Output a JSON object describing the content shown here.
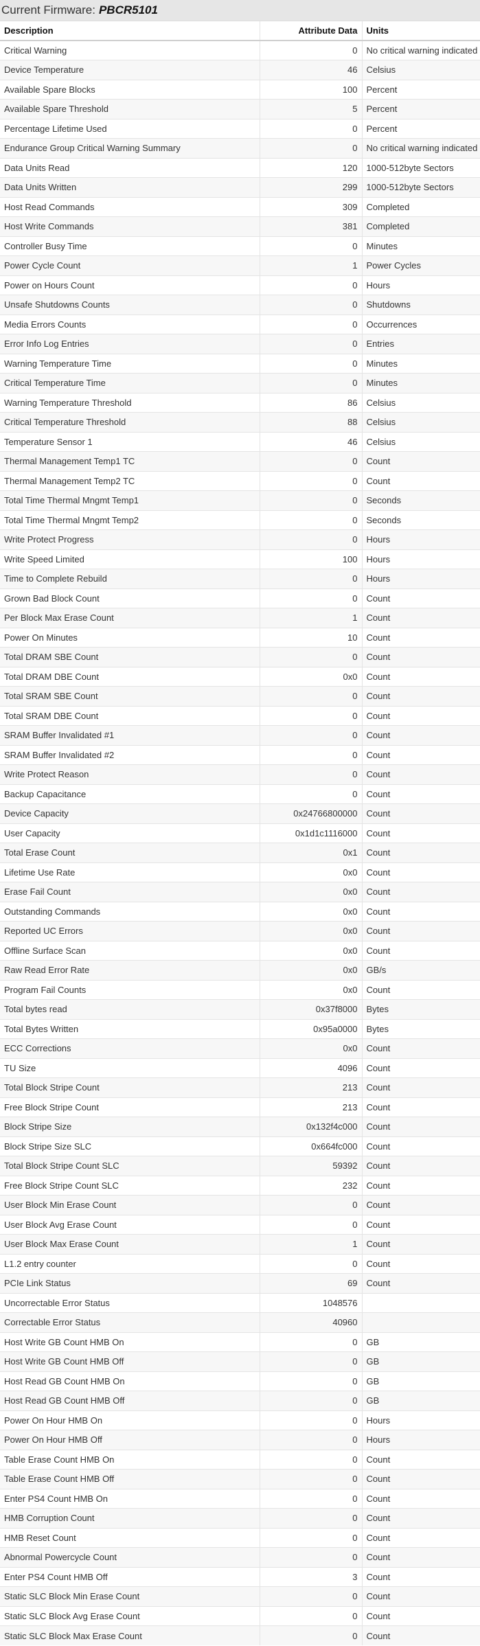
{
  "header": {
    "label": "Current Firmware:",
    "firmware": "PBCR5101"
  },
  "table": {
    "columns": [
      "Description",
      "Attribute Data",
      "Units"
    ],
    "rows": [
      {
        "d": "Critical Warning",
        "v": "0",
        "u": "No critical warning indicated"
      },
      {
        "d": "Device Temperature",
        "v": "46",
        "u": "Celsius"
      },
      {
        "d": "Available Spare Blocks",
        "v": "100",
        "u": "Percent"
      },
      {
        "d": "Available Spare Threshold",
        "v": "5",
        "u": "Percent"
      },
      {
        "d": "Percentage Lifetime Used",
        "v": "0",
        "u": "Percent"
      },
      {
        "d": "Endurance Group Critical Warning Summary",
        "v": "0",
        "u": "No critical warning indicated"
      },
      {
        "d": "Data Units Read",
        "v": "120",
        "u": "1000-512byte Sectors"
      },
      {
        "d": "Data Units Written",
        "v": "299",
        "u": "1000-512byte Sectors"
      },
      {
        "d": "Host Read Commands",
        "v": "309",
        "u": "Completed"
      },
      {
        "d": "Host Write Commands",
        "v": "381",
        "u": "Completed"
      },
      {
        "d": "Controller Busy Time",
        "v": "0",
        "u": "Minutes"
      },
      {
        "d": "Power Cycle Count",
        "v": "1",
        "u": "Power Cycles"
      },
      {
        "d": "Power on Hours Count",
        "v": "0",
        "u": "Hours"
      },
      {
        "d": "Unsafe Shutdowns Counts",
        "v": "0",
        "u": "Shutdowns"
      },
      {
        "d": "Media Errors Counts",
        "v": "0",
        "u": "Occurrences"
      },
      {
        "d": "Error Info Log Entries",
        "v": "0",
        "u": "Entries"
      },
      {
        "d": "Warning Temperature Time",
        "v": "0",
        "u": "Minutes"
      },
      {
        "d": "Critical Temperature Time",
        "v": "0",
        "u": "Minutes"
      },
      {
        "d": "Warning Temperature Threshold",
        "v": "86",
        "u": "Celsius"
      },
      {
        "d": "Critical Temperature Threshold",
        "v": "88",
        "u": "Celsius"
      },
      {
        "d": "Temperature Sensor 1",
        "v": "46",
        "u": "Celsius"
      },
      {
        "d": "Thermal Management Temp1 TC",
        "v": "0",
        "u": "Count"
      },
      {
        "d": "Thermal Management Temp2 TC",
        "v": "0",
        "u": "Count"
      },
      {
        "d": "Total Time Thermal Mngmt Temp1",
        "v": "0",
        "u": "Seconds"
      },
      {
        "d": "Total Time Thermal Mngmt Temp2",
        "v": "0",
        "u": "Seconds"
      },
      {
        "d": "Write Protect Progress",
        "v": "0",
        "u": "Hours"
      },
      {
        "d": "Write Speed Limited",
        "v": "100",
        "u": "Hours"
      },
      {
        "d": "Time to Complete Rebuild",
        "v": "0",
        "u": "Hours"
      },
      {
        "d": "Grown Bad Block Count",
        "v": "0",
        "u": "Count"
      },
      {
        "d": "Per Block Max Erase Count",
        "v": "1",
        "u": "Count"
      },
      {
        "d": "Power On Minutes",
        "v": "10",
        "u": "Count"
      },
      {
        "d": "Total DRAM SBE Count",
        "v": "0",
        "u": "Count"
      },
      {
        "d": "Total DRAM DBE Count",
        "v": "0x0",
        "u": "Count"
      },
      {
        "d": "Total SRAM SBE Count",
        "v": "0",
        "u": "Count"
      },
      {
        "d": "Total SRAM DBE Count",
        "v": "0",
        "u": "Count"
      },
      {
        "d": "SRAM Buffer Invalidated #1",
        "v": "0",
        "u": "Count"
      },
      {
        "d": "SRAM Buffer Invalidated #2",
        "v": "0",
        "u": "Count"
      },
      {
        "d": "Write Protect Reason",
        "v": "0",
        "u": "Count"
      },
      {
        "d": "Backup Capacitance",
        "v": "0",
        "u": "Count"
      },
      {
        "d": "Device Capacity",
        "v": "0x24766800000",
        "u": "Count"
      },
      {
        "d": "User Capacity",
        "v": "0x1d1c1116000",
        "u": "Count"
      },
      {
        "d": "Total Erase Count",
        "v": "0x1",
        "u": "Count"
      },
      {
        "d": "Lifetime Use Rate",
        "v": "0x0",
        "u": "Count"
      },
      {
        "d": "Erase Fail Count",
        "v": "0x0",
        "u": "Count"
      },
      {
        "d": "Outstanding Commands",
        "v": "0x0",
        "u": "Count"
      },
      {
        "d": "Reported UC Errors",
        "v": "0x0",
        "u": "Count"
      },
      {
        "d": "Offline Surface Scan",
        "v": "0x0",
        "u": "Count"
      },
      {
        "d": "Raw Read Error Rate",
        "v": "0x0",
        "u": "GB/s"
      },
      {
        "d": "Program Fail Counts",
        "v": "0x0",
        "u": "Count"
      },
      {
        "d": "Total bytes read",
        "v": "0x37f8000",
        "u": "Bytes"
      },
      {
        "d": "Total Bytes Written",
        "v": "0x95a0000",
        "u": "Bytes"
      },
      {
        "d": "ECC Corrections",
        "v": "0x0",
        "u": "Count"
      },
      {
        "d": "TU Size",
        "v": "4096",
        "u": "Count"
      },
      {
        "d": "Total Block Stripe Count",
        "v": "213",
        "u": "Count"
      },
      {
        "d": "Free Block Stripe Count",
        "v": "213",
        "u": "Count"
      },
      {
        "d": "Block Stripe Size",
        "v": "0x132f4c000",
        "u": "Count"
      },
      {
        "d": "Block Stripe Size SLC",
        "v": "0x664fc000",
        "u": "Count"
      },
      {
        "d": "Total Block Stripe Count SLC",
        "v": "59392",
        "u": "Count"
      },
      {
        "d": "Free Block Stripe Count SLC",
        "v": "232",
        "u": "Count"
      },
      {
        "d": "User Block Min Erase Count",
        "v": "0",
        "u": "Count"
      },
      {
        "d": "User Block Avg Erase Count",
        "v": "0",
        "u": "Count"
      },
      {
        "d": "User Block Max Erase Count",
        "v": "1",
        "u": "Count"
      },
      {
        "d": "L1.2 entry counter",
        "v": "0",
        "u": "Count"
      },
      {
        "d": "PCIe Link Status",
        "v": "69",
        "u": "Count"
      },
      {
        "d": "Uncorrectable Error Status",
        "v": "1048576",
        "u": ""
      },
      {
        "d": "Correctable Error Status",
        "v": "40960",
        "u": ""
      },
      {
        "d": "Host Write GB Count HMB On",
        "v": "0",
        "u": "GB"
      },
      {
        "d": "Host Write GB Count HMB Off",
        "v": "0",
        "u": "GB"
      },
      {
        "d": "Host Read GB Count HMB On",
        "v": "0",
        "u": "GB"
      },
      {
        "d": "Host Read GB Count HMB Off",
        "v": "0",
        "u": "GB"
      },
      {
        "d": "Power On Hour HMB On",
        "v": "0",
        "u": "Hours"
      },
      {
        "d": "Power On Hour HMB Off",
        "v": "0",
        "u": "Hours"
      },
      {
        "d": "Table Erase Count HMB On",
        "v": "0",
        "u": "Count"
      },
      {
        "d": "Table Erase Count HMB Off",
        "v": "0",
        "u": "Count"
      },
      {
        "d": "Enter PS4 Count HMB On",
        "v": "0",
        "u": "Count"
      },
      {
        "d": "HMB Corruption Count",
        "v": "0",
        "u": "Count"
      },
      {
        "d": "HMB Reset Count",
        "v": "0",
        "u": "Count"
      },
      {
        "d": "Abnormal Powercycle Count",
        "v": "0",
        "u": "Count"
      },
      {
        "d": "Enter PS4 Count HMB Off",
        "v": "3",
        "u": "Count"
      },
      {
        "d": "Static SLC Block Min Erase Count",
        "v": "0",
        "u": "Count"
      },
      {
        "d": "Static SLC Block Avg Erase Count",
        "v": "0",
        "u": "Count"
      },
      {
        "d": "Static SLC Block Max Erase Count",
        "v": "0",
        "u": "Count"
      }
    ]
  }
}
